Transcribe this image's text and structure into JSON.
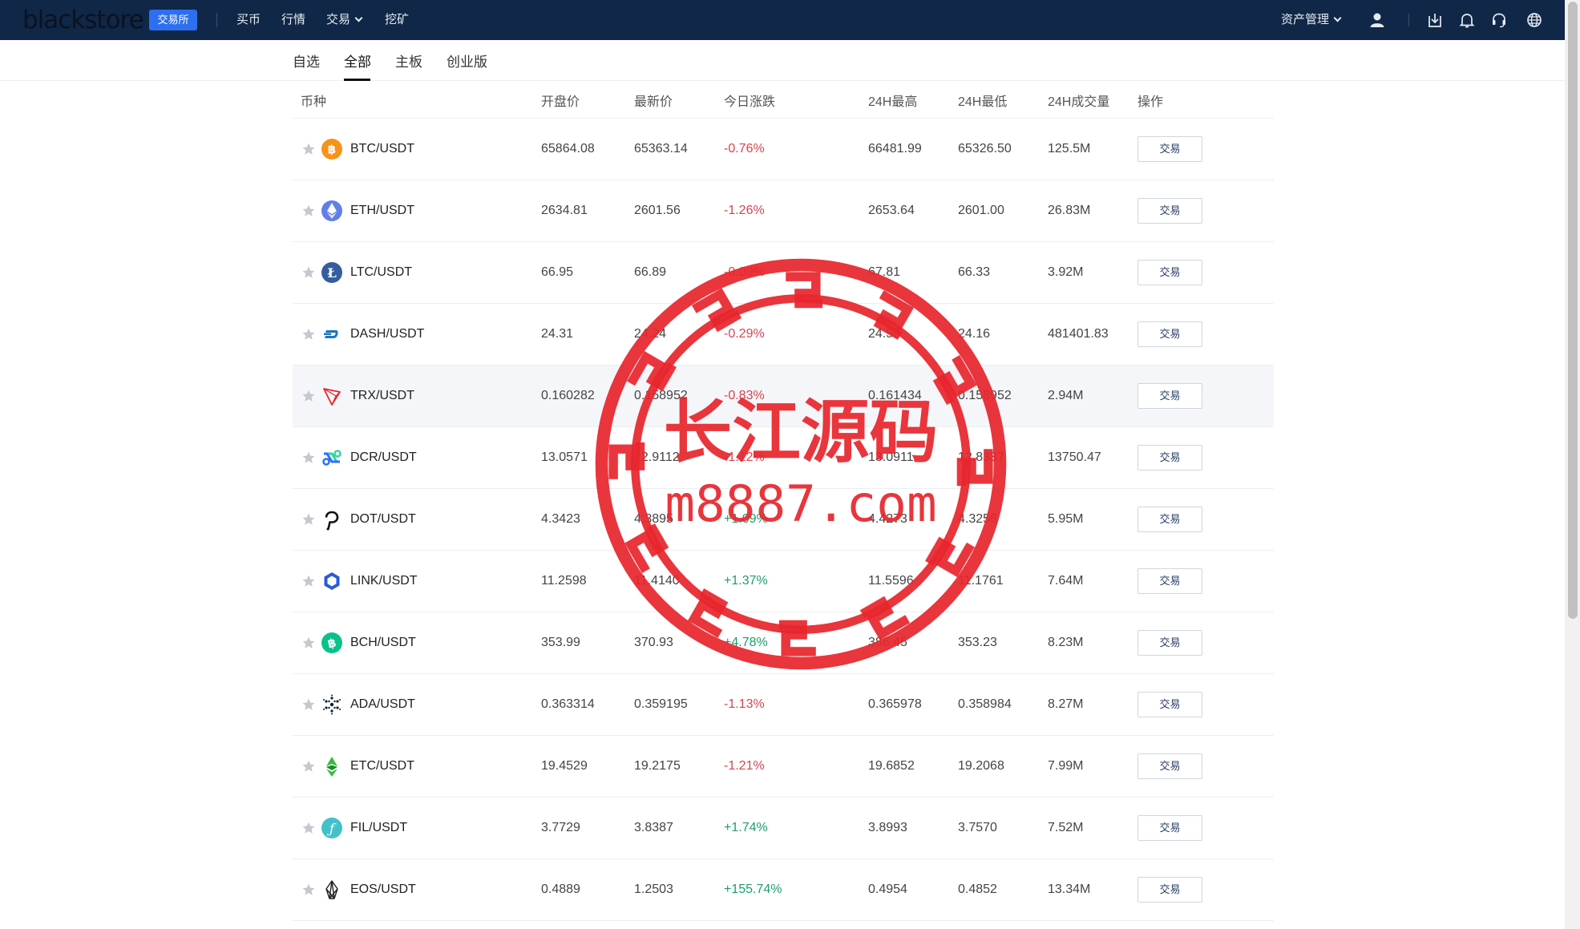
{
  "header": {
    "logo": "blackstore",
    "badge": "交易所",
    "nav": [
      {
        "label": "买币",
        "dropdown": false
      },
      {
        "label": "行情",
        "dropdown": false
      },
      {
        "label": "交易",
        "dropdown": true
      },
      {
        "label": "挖矿",
        "dropdown": false
      }
    ],
    "asset_management": "资产管理",
    "icons": [
      "user-icon",
      "download-icon",
      "bell-icon",
      "headset-icon",
      "globe-icon"
    ]
  },
  "subtabs": [
    {
      "label": "自选",
      "active": false
    },
    {
      "label": "全部",
      "active": true
    },
    {
      "label": "主板",
      "active": false
    },
    {
      "label": "创业版",
      "active": false
    }
  ],
  "table": {
    "headers": [
      "币种",
      "开盘价",
      "最新价",
      "今日涨跌",
      "24H最高",
      "24H最低",
      "24H成交量",
      "操作"
    ],
    "action_label": "交易",
    "rows": [
      {
        "pair": "BTC/USDT",
        "icon": "btc-icon",
        "open": "65864.08",
        "last": "65363.14",
        "change": "-0.76%",
        "high": "66481.99",
        "low": "65326.50",
        "volume": "125.5M"
      },
      {
        "pair": "ETH/USDT",
        "icon": "eth-icon",
        "open": "2634.81",
        "last": "2601.56",
        "change": "-1.26%",
        "high": "2653.64",
        "low": "2601.00",
        "volume": "26.83M"
      },
      {
        "pair": "LTC/USDT",
        "icon": "ltc-icon",
        "open": "66.95",
        "last": "66.89",
        "change": "-0.09%",
        "high": "67.81",
        "low": "66.33",
        "volume": "3.92M"
      },
      {
        "pair": "DASH/USDT",
        "icon": "dash-icon",
        "open": "24.31",
        "last": "24.24",
        "change": "-0.29%",
        "high": "24.58",
        "low": "24.16",
        "volume": "481401.83"
      },
      {
        "pair": "TRX/USDT",
        "icon": "trx-icon",
        "open": "0.160282",
        "last": "0.158952",
        "change": "-0.83%",
        "high": "0.161434",
        "low": "0.158952",
        "volume": "2.94M"
      },
      {
        "pair": "DCR/USDT",
        "icon": "dcr-icon",
        "open": "13.0571",
        "last": "12.9112",
        "change": "-1.12%",
        "high": "13.0911",
        "low": "12.8337",
        "volume": "13750.47"
      },
      {
        "pair": "DOT/USDT",
        "icon": "dot-icon",
        "open": "4.3423",
        "last": "4.3895",
        "change": "+1.09%",
        "high": "4.4273",
        "low": "4.3256",
        "volume": "5.95M"
      },
      {
        "pair": "LINK/USDT",
        "icon": "link-icon",
        "open": "11.2598",
        "last": "11.4140",
        "change": "+1.37%",
        "high": "11.5596",
        "low": "11.1761",
        "volume": "7.64M"
      },
      {
        "pair": "BCH/USDT",
        "icon": "bch-icon",
        "open": "353.99",
        "last": "370.93",
        "change": "+4.78%",
        "high": "386.45",
        "low": "353.23",
        "volume": "8.23M"
      },
      {
        "pair": "ADA/USDT",
        "icon": "ada-icon",
        "open": "0.363314",
        "last": "0.359195",
        "change": "-1.13%",
        "high": "0.365978",
        "low": "0.358984",
        "volume": "8.27M"
      },
      {
        "pair": "ETC/USDT",
        "icon": "etc-icon",
        "open": "19.4529",
        "last": "19.2175",
        "change": "-1.21%",
        "high": "19.6852",
        "low": "19.2068",
        "volume": "7.99M"
      },
      {
        "pair": "FIL/USDT",
        "icon": "fil-icon",
        "open": "3.7729",
        "last": "3.8387",
        "change": "+1.74%",
        "high": "3.8993",
        "low": "3.7570",
        "volume": "7.52M"
      },
      {
        "pair": "EOS/USDT",
        "icon": "eos-icon",
        "open": "0.4889",
        "last": "1.2503",
        "change": "+155.74%",
        "high": "0.4954",
        "low": "0.4852",
        "volume": "13.34M"
      }
    ]
  },
  "watermark": {
    "title": "长江源码",
    "url": "m8887.com"
  },
  "colors": {
    "topbar": "#102747",
    "badge": "#2d6ff0",
    "down": "#d9434f",
    "up": "#1f9d6e",
    "stamp": "#e8262e"
  }
}
